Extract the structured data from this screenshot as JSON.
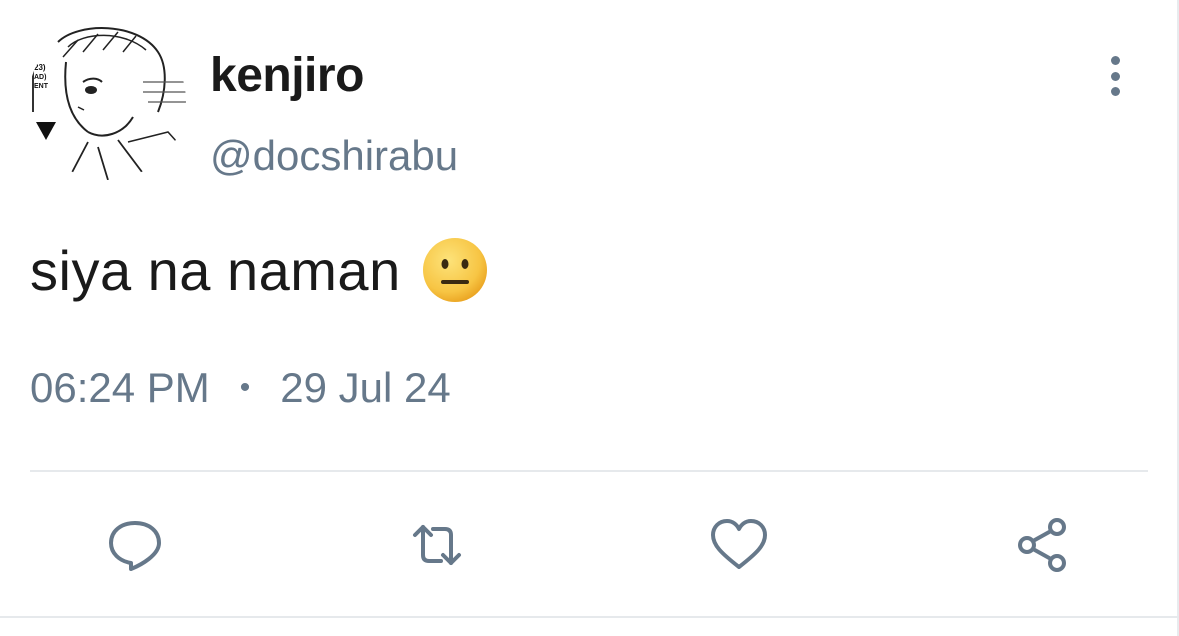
{
  "tweet": {
    "display_name": "kenjiro",
    "handle": "@docshirabu",
    "text": "siya na naman",
    "time": "06:24 PM",
    "separator": "•",
    "date": "29 Jul 24",
    "emoji": "neutral-face-emoji"
  },
  "avatar": {
    "tag_line1": "23)",
    "tag_line2": "AD)",
    "tag_line3": "ENT"
  },
  "actions": {
    "reply_icon": "reply-icon",
    "retweet_icon": "retweet-icon",
    "like_icon": "heart-icon",
    "share_icon": "share-icon",
    "more_icon": "more-vertical-icon"
  },
  "colors": {
    "text": "#1a1a1a",
    "secondary": "#66788a",
    "divider": "#e6e9ec",
    "emoji_face": "#f7c544"
  }
}
